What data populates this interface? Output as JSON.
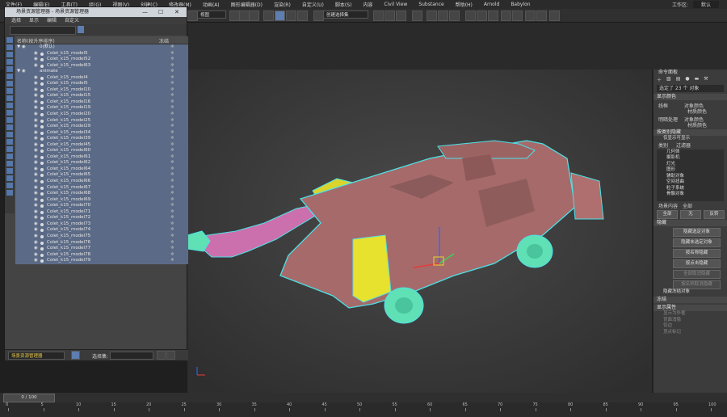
{
  "menubar": {
    "items": [
      "文件(F)",
      "编辑(E)",
      "工具(T)",
      "组(G)",
      "视图(V)",
      "创建(C)",
      "修改器(M)",
      "动画(A)",
      "图形编辑器(D)",
      "渲染(R)",
      "自定义(U)",
      "脚本(S)",
      "内容",
      "Civil View",
      "Substance",
      "帮助(H)",
      "Arnold",
      "Babylon"
    ],
    "workspace_label": "工作区:",
    "workspace_value": "默认"
  },
  "toolbar": {
    "view_dropdown": "视图",
    "selection_set": "创建选择集"
  },
  "scene_explorer": {
    "title": "场景资源管理器 - 场景资源管理器",
    "menu": [
      "选择",
      "显示",
      "编辑",
      "自定义"
    ],
    "col_name": "名称(按升序排序)",
    "col_frozen": "冻结",
    "rows": [
      {
        "type": "layer",
        "name": "0(默认)",
        "selected": true
      },
      {
        "type": "obj",
        "name": "Colet_k15_model5",
        "selected": true
      },
      {
        "type": "obj",
        "name": "Colet_k15_model52",
        "selected": true
      },
      {
        "type": "obj",
        "name": "Colet_k15_model63",
        "selected": true
      },
      {
        "type": "layer",
        "name": "animate",
        "selected": true
      },
      {
        "type": "obj",
        "name": "Colet_k15_model4",
        "selected": true
      },
      {
        "type": "obj",
        "name": "Colet_k15_model5",
        "selected": true
      },
      {
        "type": "obj",
        "name": "Colet_k15_model10",
        "selected": true
      },
      {
        "type": "obj",
        "name": "Colet_k15_model15",
        "selected": true
      },
      {
        "type": "obj",
        "name": "Colet_k15_model16",
        "selected": true
      },
      {
        "type": "obj",
        "name": "Colet_k15_model19",
        "selected": true
      },
      {
        "type": "obj",
        "name": "Colet_k15_model20",
        "selected": true
      },
      {
        "type": "obj",
        "name": "Colet_k15_model25",
        "selected": true
      },
      {
        "type": "obj",
        "name": "Colet_k15_model29",
        "selected": true
      },
      {
        "type": "obj",
        "name": "Colet_k15_model34",
        "selected": true
      },
      {
        "type": "obj",
        "name": "Colet_k15_model39",
        "selected": true
      },
      {
        "type": "obj",
        "name": "Colet_k15_model45",
        "selected": true
      },
      {
        "type": "obj",
        "name": "Colet_k15_model60",
        "selected": true
      },
      {
        "type": "obj",
        "name": "Colet_k15_model61",
        "selected": true
      },
      {
        "type": "obj",
        "name": "Colet_k15_model62",
        "selected": true
      },
      {
        "type": "obj",
        "name": "Colet_k15_model64",
        "selected": true
      },
      {
        "type": "obj",
        "name": "Colet_k15_model65",
        "selected": true
      },
      {
        "type": "obj",
        "name": "Colet_k15_model66",
        "selected": true
      },
      {
        "type": "obj",
        "name": "Colet_k15_model67",
        "selected": true
      },
      {
        "type": "obj",
        "name": "Colet_k15_model68",
        "selected": true
      },
      {
        "type": "obj",
        "name": "Colet_k15_model69",
        "selected": true
      },
      {
        "type": "obj",
        "name": "Colet_k15_model70",
        "selected": true
      },
      {
        "type": "obj",
        "name": "Colet_k15_model71",
        "selected": true
      },
      {
        "type": "obj",
        "name": "Colet_k15_model72",
        "selected": true
      },
      {
        "type": "obj",
        "name": "Colet_k15_model73",
        "selected": true
      },
      {
        "type": "obj",
        "name": "Colet_k15_model74",
        "selected": true
      },
      {
        "type": "obj",
        "name": "Colet_k15_model75",
        "selected": true
      },
      {
        "type": "obj",
        "name": "Colet_k15_model76",
        "selected": true
      },
      {
        "type": "obj",
        "name": "Colet_k15_model77",
        "selected": true
      },
      {
        "type": "obj",
        "name": "Colet_k15_model78",
        "selected": true
      },
      {
        "type": "obj",
        "name": "Colet_k15_model79",
        "selected": true
      }
    ],
    "bottom_dropdown": "场景资源管理器",
    "selection_set_label": "选择集:"
  },
  "command_panel": {
    "title": "命令面板",
    "selected_count": "选定了 23 个 对象",
    "sec_display_color": "显示颜色",
    "wireframe_label": "线框",
    "shaded_label": "明暗处理",
    "obj_color": "对象颜色",
    "mat_color": "材质颜色",
    "sec_hide_by_category": "按类别隐藏",
    "only_show_selected": "仅显示可显示",
    "category_tab": "类别",
    "filter_tab": "过滤器",
    "categories": [
      "几何体",
      "摄影机",
      "灯光",
      "图形",
      "辅助对象",
      "空间扭曲",
      "粒子系统",
      "骨骼对象"
    ],
    "scene_content": "场景内容",
    "all": "全部",
    "btn_all": "全部",
    "btn_none": "无",
    "btn_invert": "反转",
    "sec_hide": "隐藏",
    "hide_btns": [
      "隐藏选定对象",
      "隐藏未选定对象",
      "按名称隐藏",
      "按点击隐藏",
      "全部取消隐藏",
      "按名称取消隐藏"
    ],
    "hide_frozen": "隐藏冻结对象",
    "sec_freeze": "冻结",
    "sec_display_props": "显示属性",
    "display_items": [
      "显示为外框",
      "背面消隐",
      "仅边",
      "顶点标记"
    ]
  },
  "timeline": {
    "frame_label": "0 / 100"
  },
  "ruler": {
    "ticks": [
      "0",
      "5",
      "10",
      "15",
      "20",
      "25",
      "30",
      "35",
      "40",
      "45",
      "50",
      "55",
      "60",
      "65",
      "70",
      "75",
      "80",
      "85",
      "90",
      "95",
      "100"
    ]
  },
  "colors": {
    "selection_wire": "#4de1e6",
    "body": "#a86b6b",
    "wheels": "#5fe0b5",
    "yellow_part": "#e6e22e",
    "arm": "#d874b5",
    "row_selected": "#5b6a86"
  }
}
